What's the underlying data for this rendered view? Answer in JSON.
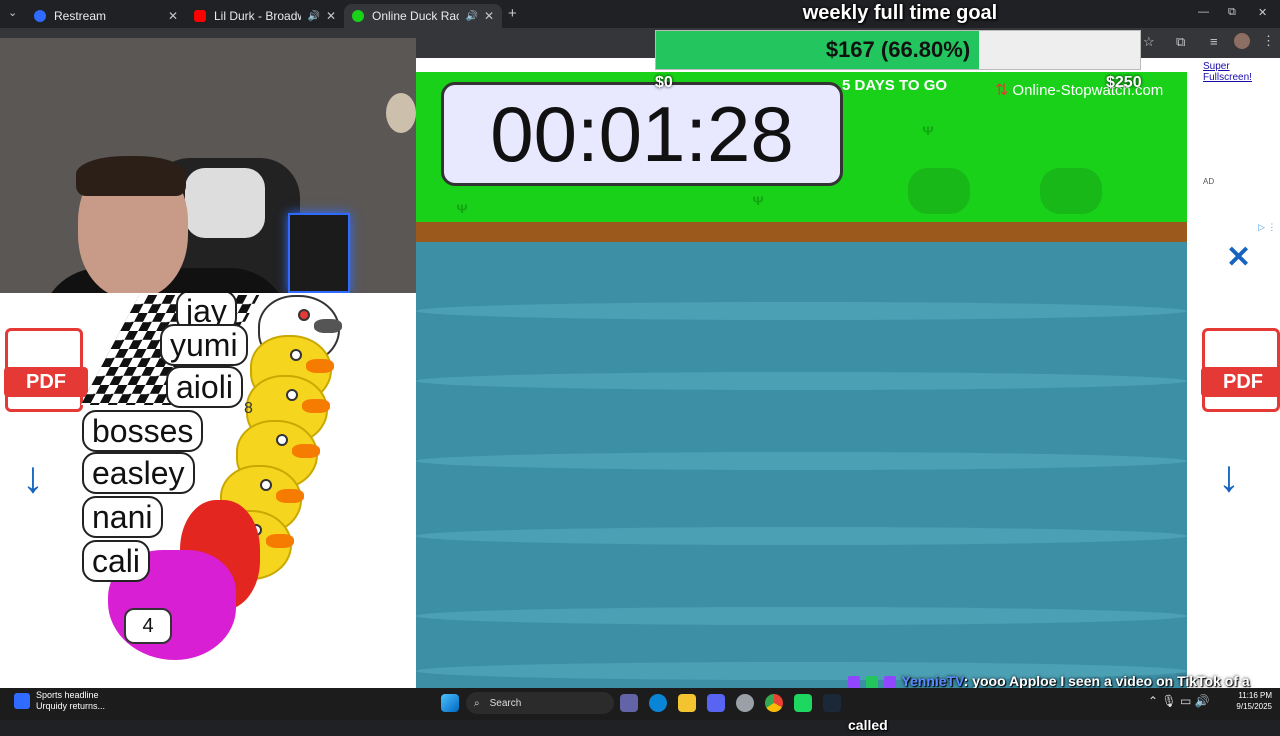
{
  "browser": {
    "tabs": [
      {
        "title": "Restream",
        "icon": "restream-favicon",
        "color": "#2f6bff"
      },
      {
        "title": "Lil Durk - Broadway Girls fe",
        "icon": "youtube-favicon",
        "color": "#ff0000"
      },
      {
        "title": "Online Duck Race Game",
        "icon": "duck-favicon",
        "color": "#19d119"
      }
    ],
    "new_tab": "+",
    "close": "✕",
    "window_controls": {
      "minimize": "—",
      "maximize": "⧉",
      "close": "✕"
    }
  },
  "goal": {
    "title": "weekly full time goal",
    "amount_text": "$167 (66.80%)",
    "progress_fraction": 0.668,
    "start": "$0",
    "end": "$250",
    "fill_color": "#22c55e"
  },
  "game": {
    "timer": "00:01:28",
    "days_to_go": "5 DAYS TO GO",
    "brand": "Online-Stopwatch.com",
    "super_fullscreen": "Super Fullscreen!",
    "ad_label": "AD",
    "racers": [
      "jay",
      "yumi",
      "aioli",
      "bosses",
      "easley",
      "nani",
      "cali"
    ],
    "duck_numbers": [
      "8",
      "4"
    ]
  },
  "ads": {
    "pdf_label": "PDF",
    "download_icon": "down-arrow-icon",
    "close_icon": "x-icon"
  },
  "chat": {
    "username": "YennieTV",
    "message": ": yooo Apploe I seen a video on TikTok of a man",
    "continuation": "called"
  },
  "taskbar": {
    "news_title": "Sports headline",
    "news_sub": "Urquidy returns...",
    "search": "Search",
    "time": "11:16 PM",
    "date": "9/15/2025"
  }
}
